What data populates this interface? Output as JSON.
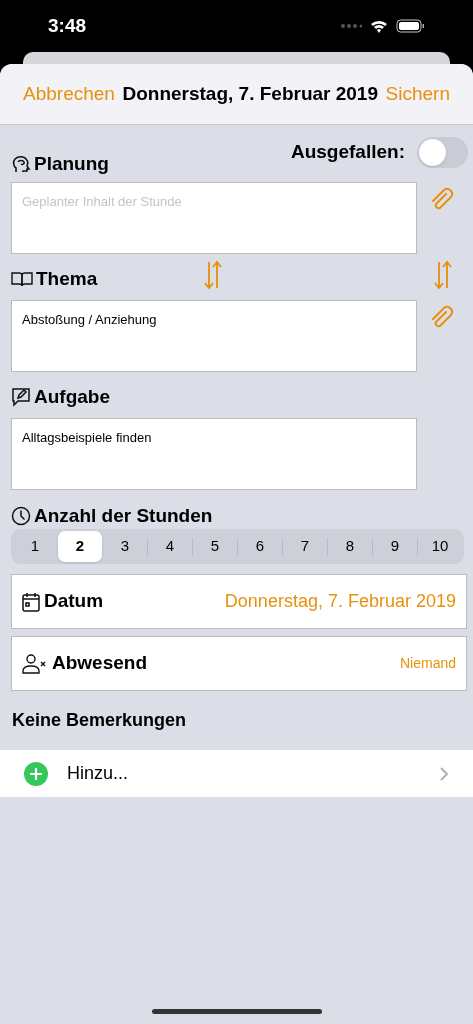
{
  "status_bar": {
    "time": "3:48"
  },
  "nav": {
    "cancel": "Abbrechen",
    "title": "Donnerstag, 7. Februar 2019",
    "save": "Sichern"
  },
  "cancelled_toggle": {
    "label": "Ausgefallen:",
    "on": false
  },
  "sections": [
    {
      "kind": "planning",
      "label": "Planung",
      "placeholder": "Geplanter Inhalt der Stunde",
      "attachment": true,
      "swap_above": false
    },
    {
      "kind": "topic",
      "label": "Thema",
      "value": "Abstoßung / Anziehung",
      "attachment": true,
      "swap_above": true
    },
    {
      "kind": "task",
      "label": "Aufgabe",
      "value": "Alltagsbeispiele finden",
      "attachment": false,
      "swap_above": false
    }
  ],
  "hours": {
    "label": "Anzahl der Stunden",
    "options": [
      {
        "label": "1",
        "selected": false
      },
      {
        "label": "2",
        "selected": true
      },
      {
        "label": "3",
        "selected": false
      },
      {
        "label": "4",
        "selected": false
      },
      {
        "label": "5",
        "selected": false
      },
      {
        "label": "6",
        "selected": false
      },
      {
        "label": "7",
        "selected": false
      },
      {
        "label": "8",
        "selected": false
      },
      {
        "label": "9",
        "selected": false
      },
      {
        "label": "10",
        "selected": false
      }
    ]
  },
  "rows": [
    {
      "kind": "date",
      "label": "Datum",
      "value": "Donnerstag, 7. Februar 2019"
    },
    {
      "kind": "absent",
      "label": "Abwesend",
      "value": "Niemand"
    }
  ],
  "remarks": {
    "heading": "Keine Bemerkungen",
    "add": "Hinzu..."
  }
}
